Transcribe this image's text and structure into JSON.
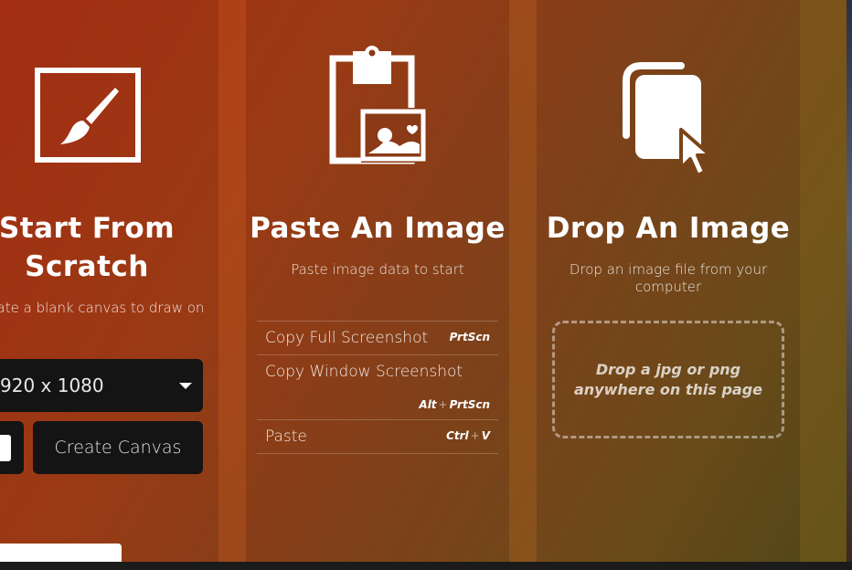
{
  "panels": {
    "scratch": {
      "icon": "paintbrush-canvas-icon",
      "title": "Start From Scratch",
      "subtitle": "ate a blank canvas to draw on",
      "size_value": "920 x 1080",
      "create_label": "Create Canvas"
    },
    "paste": {
      "icon": "clipboard-image-icon",
      "title": "Paste An Image",
      "subtitle": "Paste image data to start",
      "shortcuts": [
        {
          "label": "Copy Full Screenshot",
          "key1": "PrtScn",
          "key2": ""
        },
        {
          "label": "Copy Window Screenshot",
          "key1": "Alt",
          "key2": "PrtScn"
        },
        {
          "label": "Paste",
          "key1": "Ctrl",
          "key2": "V"
        }
      ],
      "plus": "+"
    },
    "drop": {
      "icon": "file-cursor-icon",
      "title": "Drop An Image",
      "subtitle": "Drop an image file from your computer",
      "dropzone_text": "Drop a jpg or png anywhere on this page"
    }
  },
  "colors": {
    "background_start": "#a32d12",
    "background_end": "#4e4616",
    "button_bg": "#141414",
    "text": "#ffffff"
  }
}
